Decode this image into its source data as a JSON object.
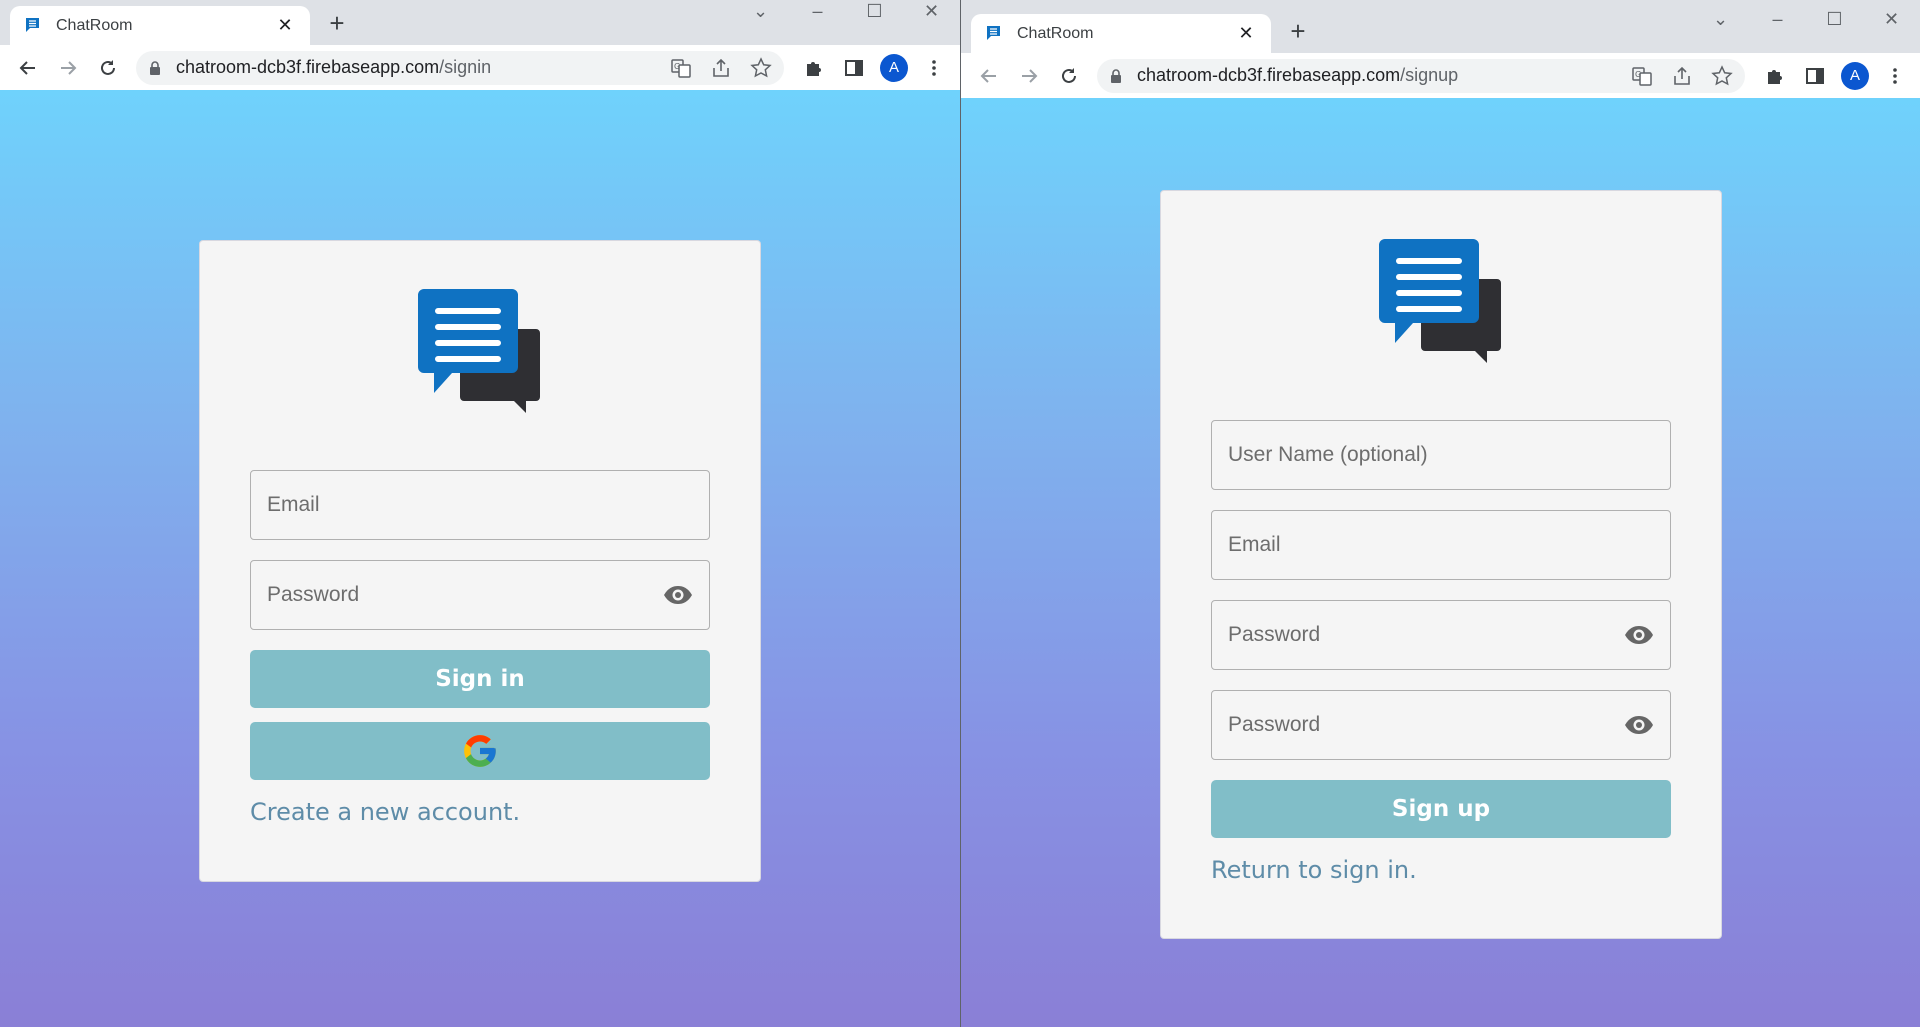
{
  "left_window": {
    "tab": {
      "title": "ChatRoom"
    },
    "address": {
      "host": "chatroom-dcb3f.firebaseapp.com",
      "path": "/signin"
    },
    "profile_initial": "A",
    "form": {
      "email_placeholder": "Email",
      "password_placeholder": "Password",
      "signin_label": "Sign in",
      "create_account_link": "Create a new account."
    }
  },
  "right_window": {
    "tab": {
      "title": "ChatRoom"
    },
    "address": {
      "host": "chatroom-dcb3f.firebaseapp.com",
      "path": "/signup"
    },
    "profile_initial": "A",
    "form": {
      "username_placeholder": "User Name (optional)",
      "email_placeholder": "Email",
      "password_placeholder": "Password",
      "confirm_password_placeholder": "Password",
      "signup_label": "Sign up",
      "return_signin_link": "Return to sign in."
    }
  },
  "colors": {
    "logo_primary": "#0f72c2",
    "logo_secondary": "#2f2f33",
    "button": "#81bec8",
    "link": "#5e8ca8",
    "gradient_top": "#6fd2fc",
    "gradient_bottom": "#8a7fd6"
  },
  "icons": [
    "chat-bubbles-icon",
    "lock-icon",
    "translate-icon",
    "share-icon",
    "star-icon",
    "puzzle-icon",
    "side-panel-icon",
    "kebab-menu-icon",
    "eye-icon",
    "google-icon",
    "back-icon",
    "forward-icon",
    "reload-icon"
  ]
}
